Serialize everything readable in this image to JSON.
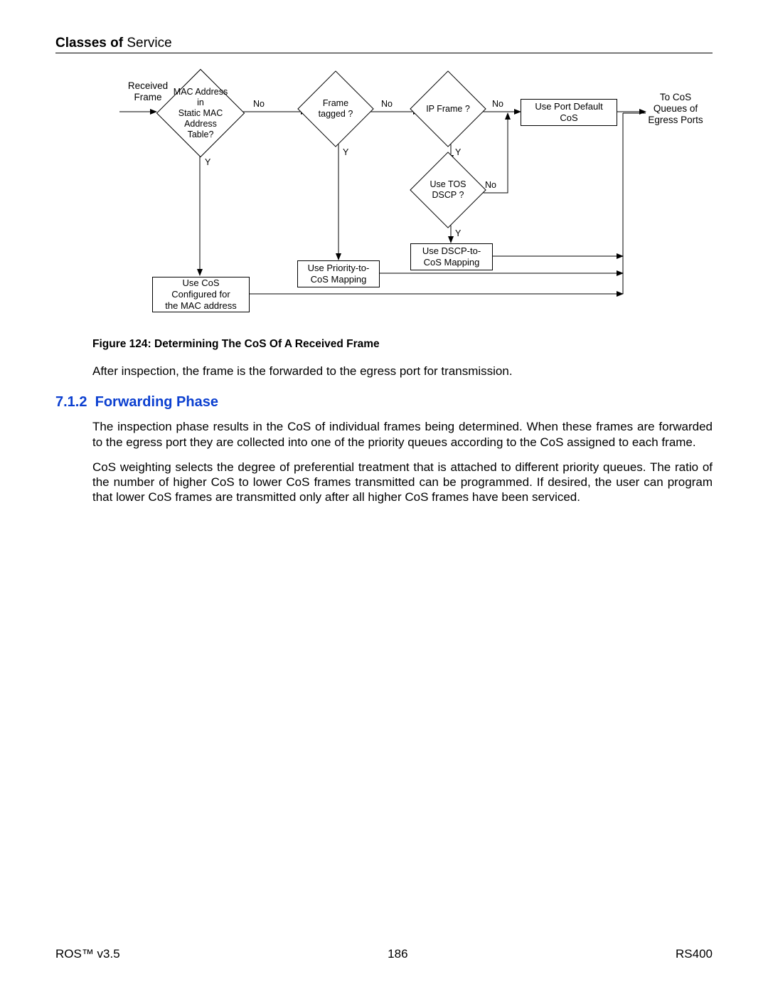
{
  "header": {
    "bold": "Classes of",
    "rest": " Service"
  },
  "flow": {
    "startLabel": "Received\nFrame",
    "endLabel": "To CoS\nQueues of\nEgress Ports",
    "decisions": {
      "mac": "MAC Address in\nStatic MAC Address\nTable?",
      "tag": "Frame\ntagged ?",
      "ip": "IP Frame ?",
      "tos": "Use TOS\nDSCP ?"
    },
    "boxes": {
      "portDefault": "Use Port Default\nCoS",
      "dscpMap": "Use DSCP-to-\nCoS Mapping",
      "prioMap": "Use Priority-to-\nCoS Mapping",
      "macCos": "Use CoS\nConfigured for\nthe MAC address"
    },
    "edgeLabels": {
      "no": "No",
      "yes": "Y"
    }
  },
  "figureCaption": "Figure 124: Determining The CoS Of A Received Frame",
  "paraAfterFigure": "After inspection, the frame is the forwarded to the egress port for transmission.",
  "section": {
    "num": "7.1.2",
    "title": "Forwarding Phase"
  },
  "para1": "The inspection phase results in the CoS of individual frames being determined.  When these frames are forwarded to the egress port they are collected into one of the priority queues according to the CoS assigned to each frame.",
  "para2": "CoS weighting selects the degree of preferential treatment that is attached to different priority queues.  The ratio of the number of higher CoS to lower CoS frames transmitted can be programmed.  If desired, the user can program that lower CoS frames are transmitted only after all higher CoS frames have been serviced.",
  "footer": {
    "left": "ROS™  v3.5",
    "center": "186",
    "right": "RS400"
  }
}
